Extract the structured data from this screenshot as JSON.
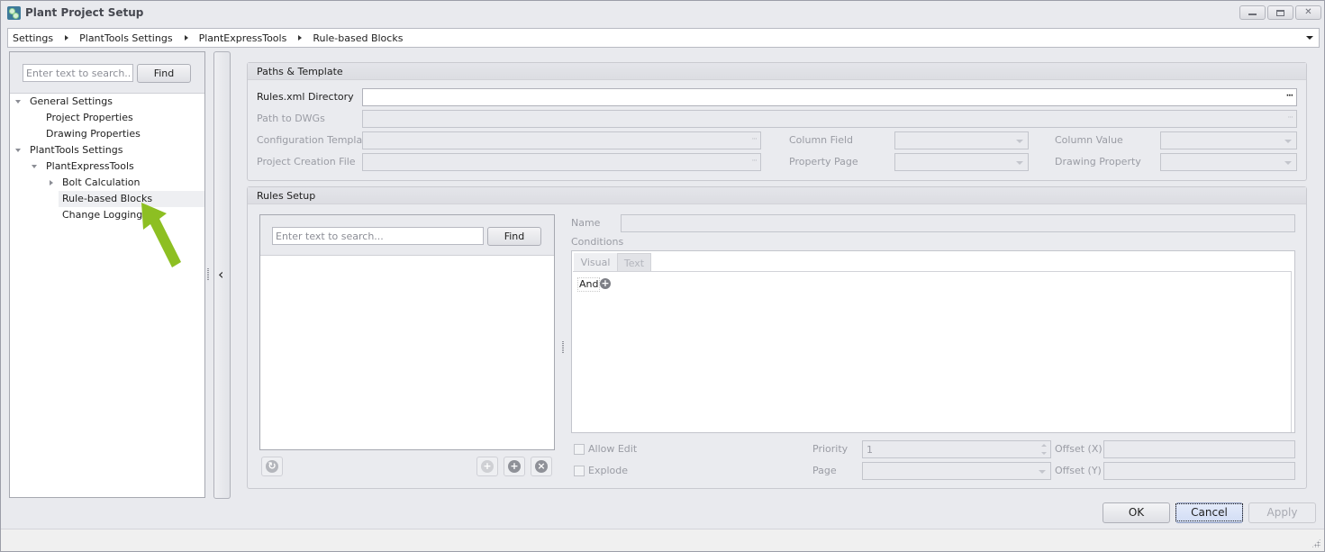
{
  "window": {
    "title": "Plant Project Setup",
    "controls": {
      "minimize": "minimize",
      "maximize": "maximize",
      "close": "close"
    }
  },
  "breadcrumb": {
    "items": [
      "Settings",
      "PlantTools Settings",
      "PlantExpressTools",
      "Rule-based Blocks"
    ]
  },
  "sidebar": {
    "search_placeholder": "Enter text to search...",
    "find_label": "Find",
    "tree": [
      {
        "label": "General Settings",
        "level": 0,
        "state": "expanded"
      },
      {
        "label": "Project Properties",
        "level": 1,
        "state": "leaf"
      },
      {
        "label": "Drawing Properties",
        "level": 1,
        "state": "leaf"
      },
      {
        "label": "PlantTools Settings",
        "level": 0,
        "state": "expanded"
      },
      {
        "label": "PlantExpressTools",
        "level": 1,
        "state": "expanded"
      },
      {
        "label": "Bolt Calculation",
        "level": 2,
        "state": "collapsed"
      },
      {
        "label": "Rule-based Blocks",
        "level": 2,
        "state": "leaf",
        "selected": true
      },
      {
        "label": "Change Logging",
        "level": 2,
        "state": "leaf"
      }
    ],
    "annotation_arrow_color": "#8dbf22"
  },
  "paths_template": {
    "header": "Paths & Template",
    "rules_xml_directory": {
      "label": "Rules.xml Directory",
      "value": ""
    },
    "path_to_dwgs": {
      "label": "Path to DWGs",
      "value": ""
    },
    "configuration_template": {
      "label": "Configuration Template",
      "value": ""
    },
    "project_creation_file": {
      "label": "Project Creation File",
      "value": ""
    },
    "column_field": {
      "label": "Column Field",
      "value": ""
    },
    "property_page": {
      "label": "Property Page",
      "value": ""
    },
    "column_value": {
      "label": "Column Value",
      "value": ""
    },
    "drawing_property": {
      "label": "Drawing Property",
      "value": ""
    },
    "ellipsis": "···"
  },
  "rules_setup": {
    "header": "Rules Setup",
    "search_placeholder": "Enter text to search...",
    "find_label": "Find",
    "name_label": "Name",
    "name_value": "",
    "conditions_label": "Conditions",
    "tabs": [
      {
        "label": "Visual",
        "active": true
      },
      {
        "label": "Text",
        "active": false
      }
    ],
    "and_label": "And",
    "allow_edit": {
      "label": "Allow Edit",
      "checked": false
    },
    "explode": {
      "label": "Explode",
      "checked": false
    },
    "priority": {
      "label": "Priority",
      "value": "1"
    },
    "page": {
      "label": "Page",
      "value": ""
    },
    "offset_x": {
      "label": "Offset (X)",
      "value": ""
    },
    "offset_y": {
      "label": "Offset (Y)",
      "value": ""
    }
  },
  "footer": {
    "ok_label": "OK",
    "cancel_label": "Cancel",
    "apply_label": "Apply"
  }
}
